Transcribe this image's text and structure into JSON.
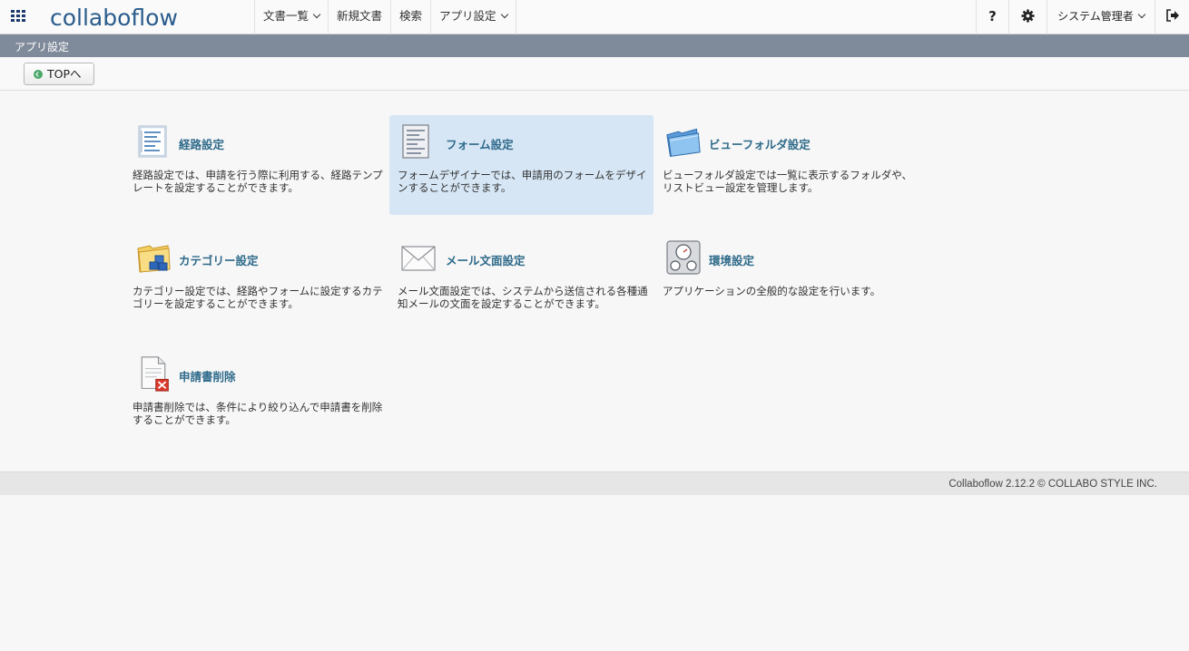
{
  "header": {
    "logo_text": "collaboflow",
    "apps_icon": "grid-icon",
    "menu": [
      {
        "label": "文書一覧",
        "has_dropdown": true
      },
      {
        "label": "新規文書",
        "has_dropdown": false
      },
      {
        "label": "検索",
        "has_dropdown": false
      },
      {
        "label": "アプリ設定",
        "has_dropdown": true
      }
    ],
    "help_label": "?",
    "settings_icon": "gear-icon",
    "user_label": "システム管理者",
    "logout_icon": "logout-icon"
  },
  "subbar": {
    "title": "アプリ設定"
  },
  "toolbar": {
    "top_button": "TOPへ",
    "top_button_icon": "circle-arrow-icon"
  },
  "cards": [
    {
      "title": "経路設定",
      "desc": "経路設定では、申請を行う際に利用する、経路テンプレートを設定することができます。",
      "icon": "route-list-icon"
    },
    {
      "title": "フォーム設定",
      "desc": "フォームデザイナーでは、申請用のフォームをデザインすることができます。",
      "icon": "form-document-icon"
    },
    {
      "title": "ビューフォルダ設定",
      "desc": "ビューフォルダ設定では一覧に表示するフォルダや、リストビュー設定を管理します。",
      "icon": "folder-icon"
    },
    {
      "title": "カテゴリー設定",
      "desc": "カテゴリー設定では、経路やフォームに設定するカテゴリーを設定することができます。",
      "icon": "category-cubes-icon"
    },
    {
      "title": "メール文面設定",
      "desc": "メール文面設定では、システムから送信される各種通知メールの文面を設定することができます。",
      "icon": "envelope-icon"
    },
    {
      "title": "環境設定",
      "desc": "アプリケーションの全般的な設定を行います。",
      "icon": "environment-gauges-icon"
    },
    {
      "title": "申請書削除",
      "desc": "申請書削除では、条件により絞り込んで申請書を削除することができます。",
      "icon": "delete-document-icon"
    }
  ],
  "footer": {
    "text": "Collaboflow 2.12.2 © COLLABO STYLE INC."
  },
  "colors": {
    "subbar": "#7f8a9a",
    "card_title": "#2e6a8a",
    "highlight": "#d6e6f5",
    "logo": "#2a5c8c"
  }
}
